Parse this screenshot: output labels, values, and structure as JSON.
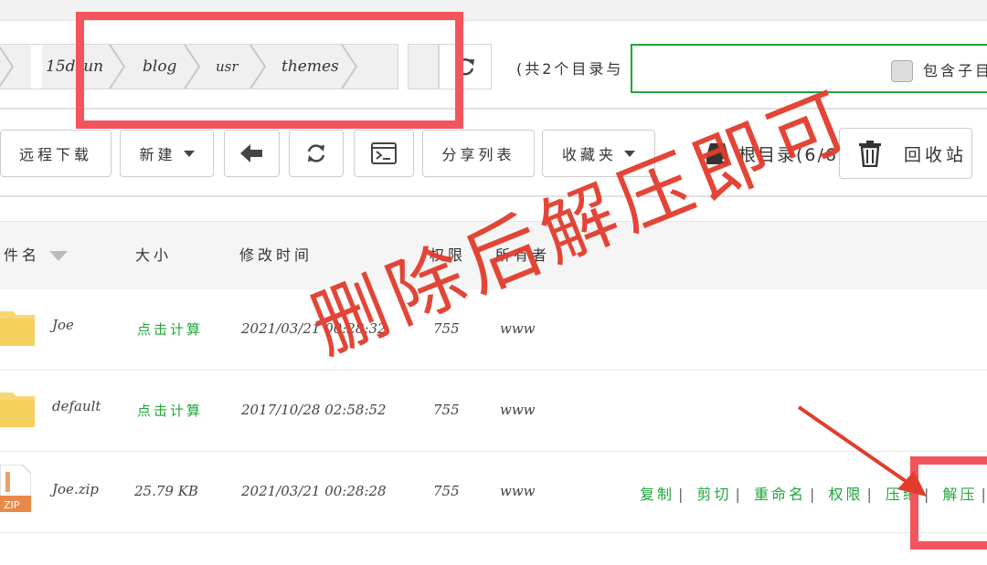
{
  "breadcrumb": {
    "items": [
      "15dsun",
      "blog",
      "usr",
      "themes"
    ]
  },
  "path_info": {
    "dir_count_text": "(共2个目录与"
  },
  "search": {
    "value": "",
    "subdir_label": "包含子目"
  },
  "toolbar": {
    "remote_download": "远程下载",
    "new": "新建",
    "share_list": "分享列表",
    "favorites": "收藏夹",
    "root_dir": "根目录(6/6)",
    "recycle_bin": "回收站"
  },
  "table": {
    "headers": {
      "name": "件名",
      "size": "大小",
      "mtime": "修改时间",
      "perm": "权限",
      "owner": "所有者"
    },
    "rows": [
      {
        "name": "Joe",
        "size": "点击计算",
        "mtime": "2021/03/21 00:28:32",
        "perm": "755",
        "owner": "www",
        "type": "folder"
      },
      {
        "name": "default",
        "size": "点击计算",
        "mtime": "2017/10/28 02:58:52",
        "perm": "755",
        "owner": "www",
        "type": "folder"
      },
      {
        "name": "Joe.zip",
        "size": "25.79 KB",
        "mtime": "2021/03/21 00:28:28",
        "perm": "755",
        "owner": "www",
        "type": "zip"
      }
    ],
    "zip_label": "ZIP",
    "actions": [
      "复制",
      "剪切",
      "重命名",
      "权限",
      "压缩",
      "解压"
    ]
  },
  "annotation": {
    "text": "删除后解压即可",
    "color": "#e23c2c",
    "box_color": "#f2555e"
  },
  "colors": {
    "accent": "#20a53a"
  }
}
